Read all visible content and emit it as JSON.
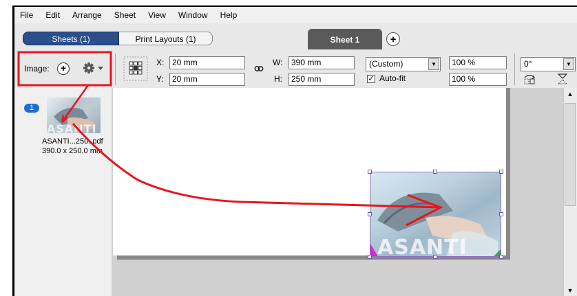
{
  "menubar": {
    "items": [
      "File",
      "Edit",
      "Arrange",
      "Sheet",
      "View",
      "Window",
      "Help"
    ]
  },
  "tabs": {
    "sheets_label": "Sheets (1)",
    "print_layouts_label": "Print Layouts (1)",
    "sheet_tab_label": "Sheet 1",
    "add_sheet_symbol": "+"
  },
  "toolbar": {
    "images_label": "Image:",
    "add_symbol": "+",
    "x_label": "X:",
    "x_value": "20 mm",
    "y_label": "Y:",
    "y_value": "20 mm",
    "w_label": "W:",
    "w_value": "390 mm",
    "h_label": "H:",
    "h_value": "250 mm",
    "size_preset": "(Custom)",
    "autofit_label": "Auto-fit",
    "autofit_checked": "✓",
    "scale_x": "100 %",
    "scale_y": "100 %",
    "rotation": "0°"
  },
  "panel": {
    "badge": "1",
    "file_name": "ASANTI...250..pdf",
    "file_size": "390.0 x 250.0 mm",
    "thumb_text": "ASANTI"
  },
  "canvas": {
    "placed_watermark": "ASANTI"
  },
  "colors": {
    "annotation_red": "#e8141e",
    "selection_purple": "#7050c0",
    "sheets_tab_blue": "#2a4f8a"
  }
}
